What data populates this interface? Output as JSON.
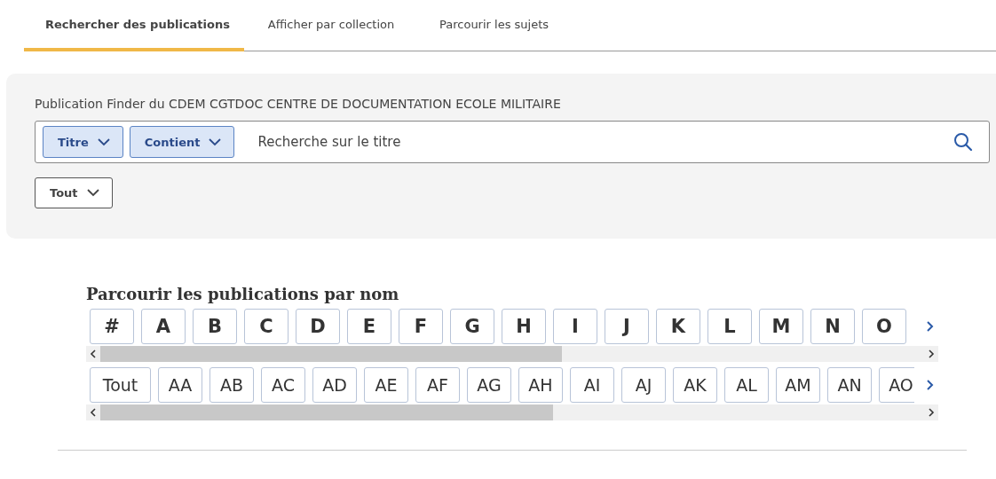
{
  "tabs": [
    {
      "label": "Rechercher des publications",
      "selected": true
    },
    {
      "label": "Afficher par collection",
      "selected": false
    },
    {
      "label": "Parcourir les sujets",
      "selected": false
    }
  ],
  "search_panel": {
    "title": "Publication Finder du CDEM CGTDOC CENTRE DE DOCUMENTATION ECOLE MILITAIRE",
    "field_dropdown": "Titre",
    "match_dropdown": "Contient",
    "placeholder": "Recherche sur le titre",
    "scope_dropdown": "Tout"
  },
  "browse": {
    "heading": "Parcourir les publications par nom",
    "letters": [
      "#",
      "A",
      "B",
      "C",
      "D",
      "E",
      "F",
      "G",
      "H",
      "I",
      "J",
      "K",
      "L",
      "M",
      "N",
      "O"
    ],
    "prefixes": [
      "Tout",
      "AA",
      "AB",
      "AC",
      "AD",
      "AE",
      "AF",
      "AG",
      "AH",
      "AI",
      "AJ",
      "AK",
      "AL",
      "AM",
      "AN",
      "AO"
    ]
  }
}
